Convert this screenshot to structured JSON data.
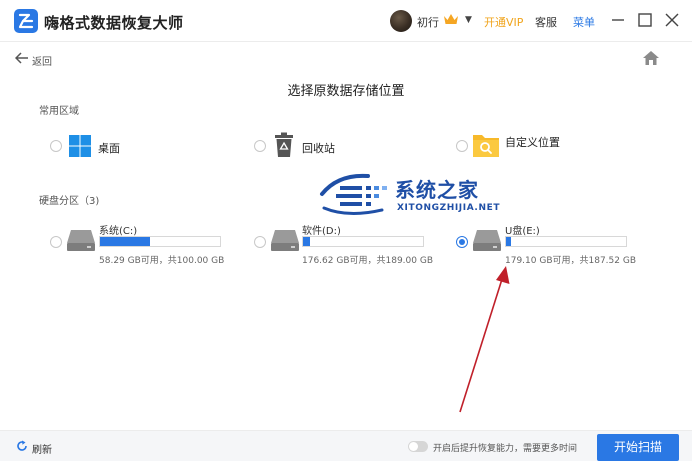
{
  "titlebar": {
    "app_title": "嗨格式数据恢复大师",
    "username": "初行",
    "dropdown_glyph": "▼",
    "vip_label": "开通VIP",
    "service_label": "客服",
    "menu_label": "菜单"
  },
  "nav": {
    "back_label": "返回"
  },
  "page": {
    "title": "选择原数据存储位置"
  },
  "common": {
    "section_label": "常用区域",
    "items": [
      {
        "label": "桌面",
        "icon": "windows-icon"
      },
      {
        "label": "回收站",
        "icon": "recycle-bin-icon"
      },
      {
        "label": "自定义位置",
        "icon": "folder-search-icon"
      }
    ]
  },
  "disks": {
    "section_label": "硬盘分区（3)",
    "items": [
      {
        "name": "系统(C:)",
        "info": "58.29 GB可用，共100.00 GB",
        "used_fraction": 0.42,
        "selected": false
      },
      {
        "name": "软件(D:)",
        "info": "176.62 GB可用，共189.00 GB",
        "used_fraction": 0.06,
        "selected": false
      },
      {
        "name": "U盘(E:)",
        "info": "179.10 GB可用，共187.52 GB",
        "used_fraction": 0.04,
        "selected": true
      }
    ]
  },
  "watermark": {
    "title": "系统之家",
    "subtitle": "XITONGZHIJIA.NET"
  },
  "footer": {
    "refresh_label": "刷新",
    "toggle_label": "开启后提升恢复能力，需要更多时间",
    "start_label": "开始扫描"
  },
  "colors": {
    "accent": "#2a78e4",
    "vip": "#f0a41c",
    "arrow": "#c0202a"
  }
}
